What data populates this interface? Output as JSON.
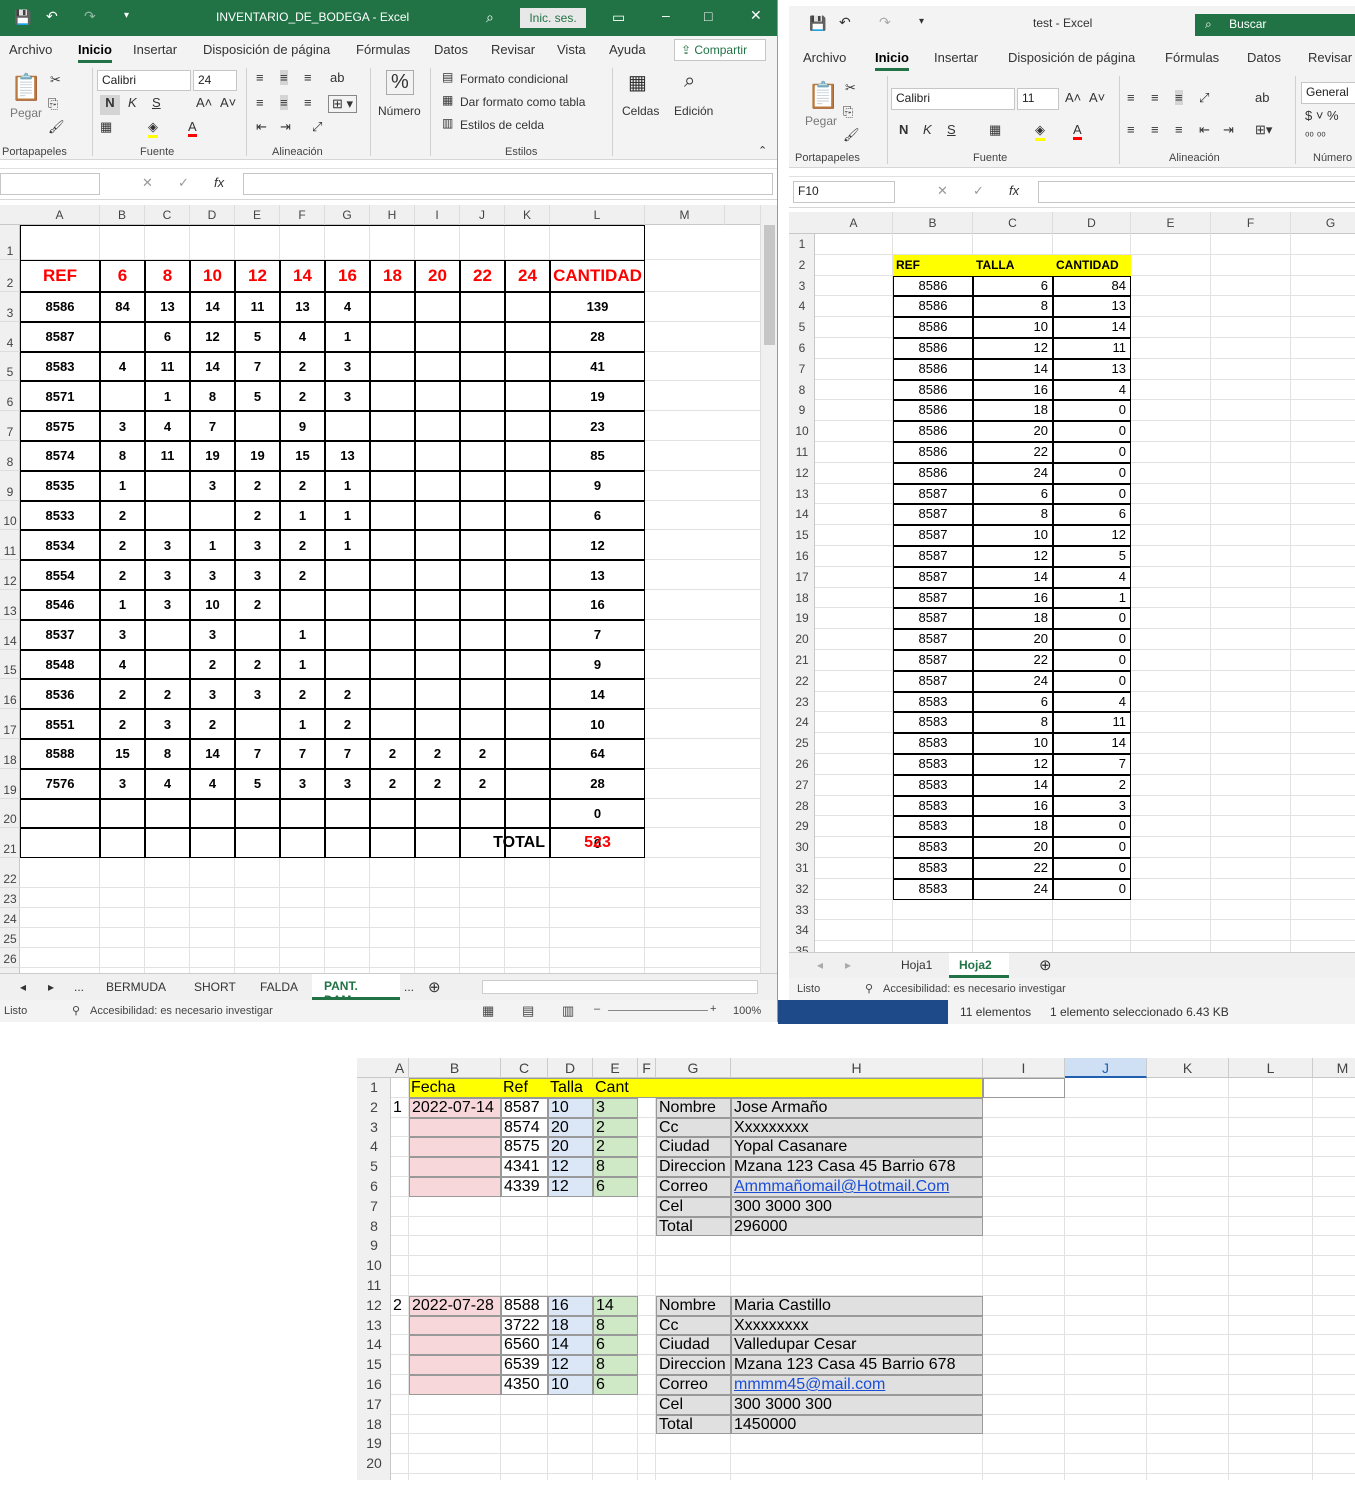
{
  "win1": {
    "title": "INVENTARIO_DE_BODEGA  -  Excel",
    "signin": "Inic. ses.",
    "menu": [
      "Archivo",
      "Inicio",
      "Insertar",
      "Disposición de página",
      "Fórmulas",
      "Datos",
      "Revisar",
      "Vista",
      "Ayuda"
    ],
    "share": "Compartir",
    "font": "Calibri",
    "size": "24",
    "groups": {
      "clipboard": "Portapapeles",
      "font": "Fuente",
      "align": "Alineación",
      "styles": "Estilos"
    },
    "paste": "Pegar",
    "number": "Número",
    "styles": [
      "Formato condicional",
      "Dar formato como tabla",
      "Estilos de celda"
    ],
    "cells": "Celdas",
    "edit": "Edición",
    "cols": [
      "A",
      "B",
      "C",
      "D",
      "E",
      "F",
      "G",
      "H",
      "I",
      "J",
      "K",
      "L",
      "M"
    ],
    "rows": [
      "1",
      "2",
      "3",
      "4",
      "5",
      "6",
      "7",
      "8",
      "9",
      "10",
      "11",
      "12",
      "13",
      "14",
      "15",
      "16",
      "17",
      "18",
      "19",
      "20",
      "21",
      "22",
      "23",
      "24",
      "25",
      "26"
    ],
    "header": [
      "REF",
      "6",
      "8",
      "10",
      "12",
      "14",
      "16",
      "18",
      "20",
      "22",
      "24",
      "CANTIDAD"
    ],
    "data": [
      [
        "8586",
        "84",
        "13",
        "14",
        "11",
        "13",
        "4",
        "",
        "",
        "",
        "",
        "139"
      ],
      [
        "8587",
        "",
        "6",
        "12",
        "5",
        "4",
        "1",
        "",
        "",
        "",
        "",
        "28"
      ],
      [
        "8583",
        "4",
        "11",
        "14",
        "7",
        "2",
        "3",
        "",
        "",
        "",
        "",
        "41"
      ],
      [
        "8571",
        "",
        "1",
        "8",
        "5",
        "2",
        "3",
        "",
        "",
        "",
        "",
        "19"
      ],
      [
        "8575",
        "3",
        "4",
        "7",
        "",
        "9",
        "",
        "",
        "",
        "",
        "",
        "23"
      ],
      [
        "8574",
        "8",
        "11",
        "19",
        "19",
        "15",
        "13",
        "",
        "",
        "",
        "",
        "85"
      ],
      [
        "8535",
        "1",
        "",
        "3",
        "2",
        "2",
        "1",
        "",
        "",
        "",
        "",
        "9"
      ],
      [
        "8533",
        "2",
        "",
        "",
        "2",
        "1",
        "1",
        "",
        "",
        "",
        "",
        "6"
      ],
      [
        "8534",
        "2",
        "3",
        "1",
        "3",
        "2",
        "1",
        "",
        "",
        "",
        "",
        "12"
      ],
      [
        "8554",
        "2",
        "3",
        "3",
        "3",
        "2",
        "",
        "",
        "",
        "",
        "",
        "13"
      ],
      [
        "8546",
        "1",
        "3",
        "10",
        "2",
        "",
        "",
        "",
        "",
        "",
        "",
        "16"
      ],
      [
        "8537",
        "3",
        "",
        "3",
        "",
        "1",
        "",
        "",
        "",
        "",
        "",
        "7"
      ],
      [
        "8548",
        "4",
        "",
        "2",
        "2",
        "1",
        "",
        "",
        "",
        "",
        "",
        "9"
      ],
      [
        "8536",
        "2",
        "2",
        "3",
        "3",
        "2",
        "2",
        "",
        "",
        "",
        "",
        "14"
      ],
      [
        "8551",
        "2",
        "3",
        "2",
        "",
        "1",
        "2",
        "",
        "",
        "",
        "",
        "10"
      ],
      [
        "8588",
        "15",
        "8",
        "14",
        "7",
        "7",
        "7",
        "2",
        "2",
        "2",
        "",
        "64"
      ],
      [
        "7576",
        "3",
        "4",
        "4",
        "5",
        "3",
        "3",
        "2",
        "2",
        "2",
        "",
        "28"
      ],
      [
        "",
        "",
        "",
        "",
        "",
        "",
        "",
        "",
        "",
        "",
        "",
        "0"
      ],
      [
        "",
        "",
        "",
        "",
        "",
        "",
        "",
        "",
        "",
        "",
        "",
        "0"
      ]
    ],
    "total_label": "TOTAL",
    "total": "523",
    "sheets": [
      "...",
      "BERMUDA",
      "SHORT",
      "FALDA",
      "PANT. DAM",
      "..."
    ],
    "status": "Listo",
    "access": "Accesibilidad: es necesario investigar",
    "zoom": "100%"
  },
  "win2": {
    "title": "test  -  Excel",
    "search": "Buscar",
    "menu": [
      "Archivo",
      "Inicio",
      "Insertar",
      "Disposición de página",
      "Fórmulas",
      "Datos",
      "Revisar"
    ],
    "font": "Calibri",
    "size": "11",
    "numfmt": "General",
    "groups": {
      "clipboard": "Portapapeles",
      "font": "Fuente",
      "align": "Alineación",
      "number": "Número"
    },
    "paste": "Pegar",
    "namebox": "F10",
    "cols": [
      "A",
      "B",
      "C",
      "D",
      "E",
      "F",
      "G"
    ],
    "rows": [
      "1",
      "2",
      "3",
      "4",
      "5",
      "6",
      "7",
      "8",
      "9",
      "10",
      "11",
      "12",
      "13",
      "14",
      "15",
      "16",
      "17",
      "18",
      "19",
      "20",
      "21",
      "22",
      "23",
      "24",
      "25",
      "26",
      "27",
      "28",
      "29",
      "30",
      "31",
      "32",
      "33",
      "34",
      "35"
    ],
    "header": [
      "REF",
      "TALLA",
      "CANTIDAD"
    ],
    "data": [
      [
        "8586",
        "6",
        "84"
      ],
      [
        "8586",
        "8",
        "13"
      ],
      [
        "8586",
        "10",
        "14"
      ],
      [
        "8586",
        "12",
        "11"
      ],
      [
        "8586",
        "14",
        "13"
      ],
      [
        "8586",
        "16",
        "4"
      ],
      [
        "8586",
        "18",
        "0"
      ],
      [
        "8586",
        "20",
        "0"
      ],
      [
        "8586",
        "22",
        "0"
      ],
      [
        "8586",
        "24",
        "0"
      ],
      [
        "8587",
        "6",
        "0"
      ],
      [
        "8587",
        "8",
        "6"
      ],
      [
        "8587",
        "10",
        "12"
      ],
      [
        "8587",
        "12",
        "5"
      ],
      [
        "8587",
        "14",
        "4"
      ],
      [
        "8587",
        "16",
        "1"
      ],
      [
        "8587",
        "18",
        "0"
      ],
      [
        "8587",
        "20",
        "0"
      ],
      [
        "8587",
        "22",
        "0"
      ],
      [
        "8587",
        "24",
        "0"
      ],
      [
        "8583",
        "6",
        "4"
      ],
      [
        "8583",
        "8",
        "11"
      ],
      [
        "8583",
        "10",
        "14"
      ],
      [
        "8583",
        "12",
        "7"
      ],
      [
        "8583",
        "14",
        "2"
      ],
      [
        "8583",
        "16",
        "3"
      ],
      [
        "8583",
        "18",
        "0"
      ],
      [
        "8583",
        "20",
        "0"
      ],
      [
        "8583",
        "22",
        "0"
      ],
      [
        "8583",
        "24",
        "0"
      ]
    ],
    "sheets": [
      "Hoja1",
      "Hoja2"
    ],
    "status": "Listo",
    "access": "Accesibilidad: es necesario investigar"
  },
  "explorer": {
    "items": "11 elementos",
    "selected": "1 elemento seleccionado  6.43 KB"
  },
  "sheet3": {
    "cols": [
      "A",
      "B",
      "C",
      "D",
      "E",
      "F",
      "G",
      "H",
      "I",
      "J",
      "K",
      "L",
      "M"
    ],
    "rows": [
      "1",
      "2",
      "3",
      "4",
      "5",
      "6",
      "7",
      "8",
      "9",
      "10",
      "11",
      "12",
      "13",
      "14",
      "15",
      "16",
      "17",
      "18",
      "19",
      "20"
    ],
    "header": [
      "Fecha",
      "Ref",
      "Talla",
      "Cant"
    ],
    "orders": [
      {
        "num": "1",
        "fecha": "2022-07-14",
        "items": [
          [
            "8587",
            "10",
            "3"
          ],
          [
            "8574",
            "20",
            "2"
          ],
          [
            "8575",
            "20",
            "2"
          ],
          [
            "4341",
            "12",
            "8"
          ],
          [
            "4339",
            "12",
            "6"
          ]
        ],
        "info": [
          [
            "Nombre",
            "Jose Armaño"
          ],
          [
            "Cc",
            "Xxxxxxxxx"
          ],
          [
            "Ciudad",
            "Yopal Casanare"
          ],
          [
            "Direccion",
            "Mzana 123 Casa 45 Barrio 678"
          ],
          [
            "Correo",
            "Ammmañomail@Hotmail.Com"
          ],
          [
            "Cel",
            "300 3000 300"
          ],
          [
            "Total",
            "296000"
          ]
        ]
      },
      {
        "num": "2",
        "fecha": "2022-07-28",
        "items": [
          [
            "8588",
            "16",
            "14"
          ],
          [
            "3722",
            "18",
            "8"
          ],
          [
            "6560",
            "14",
            "6"
          ],
          [
            "6539",
            "12",
            "8"
          ],
          [
            "4350",
            "10",
            "6"
          ]
        ],
        "info": [
          [
            "Nombre",
            "Maria Castillo"
          ],
          [
            "Cc",
            "Xxxxxxxxx"
          ],
          [
            "Ciudad",
            "Valledupar Cesar"
          ],
          [
            "Direccion",
            "Mzana 123 Casa 45 Barrio 678"
          ],
          [
            "Correo",
            "mmmm45@mail.com"
          ],
          [
            "Cel",
            "300 3000 300"
          ],
          [
            "Total",
            "1450000"
          ]
        ]
      }
    ]
  }
}
